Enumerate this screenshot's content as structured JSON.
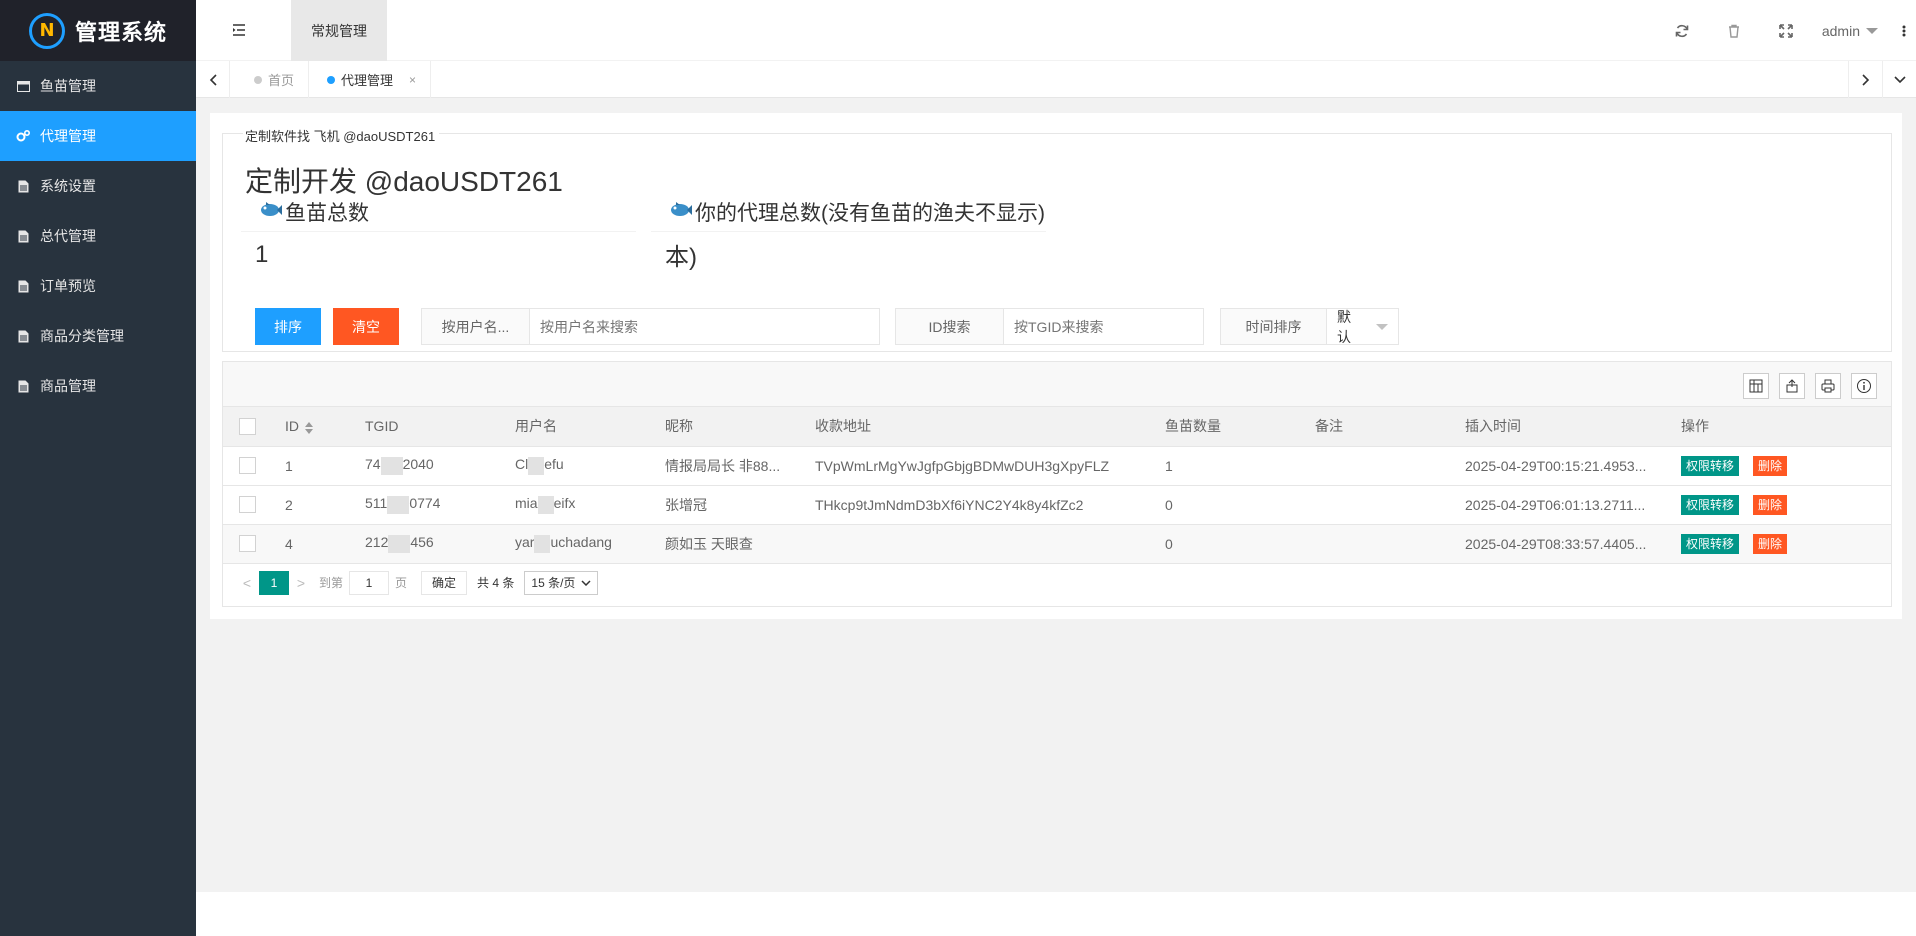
{
  "app": {
    "title": "管理系统",
    "logo_letter": "N"
  },
  "sidebar": {
    "items": [
      {
        "label": "鱼苗管理",
        "icon": "window-icon",
        "active": false
      },
      {
        "label": "代理管理",
        "icon": "gears-icon",
        "active": true
      },
      {
        "label": "系统设置",
        "icon": "document-icon",
        "active": false
      },
      {
        "label": "总代管理",
        "icon": "document-icon",
        "active": false
      },
      {
        "label": "订单预览",
        "icon": "document-icon",
        "active": false
      },
      {
        "label": "商品分类管理",
        "icon": "document-icon",
        "active": false
      },
      {
        "label": "商品管理",
        "icon": "document-icon",
        "active": false
      }
    ]
  },
  "header": {
    "nav_tab": "常规管理",
    "user": "admin"
  },
  "tabs": {
    "home": "首页",
    "current": "代理管理",
    "close": "×"
  },
  "panel": {
    "legend": "定制软件找 飞机 @daoUSDT261",
    "title": "定制开发 @daoUSDT261",
    "stats": [
      {
        "label": "鱼苗总数",
        "value": "1"
      },
      {
        "label": "你的代理总数(没有鱼苗的渔夫不显示)",
        "value": ""
      }
    ],
    "overlap_text": "本)"
  },
  "toolbar": {
    "sort_button": "排序",
    "clear_button": "清空",
    "username_label": "按用户名...",
    "username_placeholder": "按用户名来搜索",
    "id_label": "ID搜索",
    "id_placeholder": "按TGID来搜索",
    "time_label": "时间排序",
    "time_value": "默认"
  },
  "table": {
    "columns": [
      "ID",
      "TGID",
      "用户名",
      "昵称",
      "收款地址",
      "鱼苗数量",
      "备注",
      "插入时间",
      "操作"
    ],
    "rows": [
      {
        "id": "1",
        "tgid_a": "74",
        "tgid_b": "2040",
        "user_a": "Cl",
        "user_b": "efu",
        "nickname": "情报局局长 非88...",
        "address": "TVpWmLrMgYwJgfpGbjgBDMwDUH3gXpyFLZ",
        "count": "1",
        "note": "",
        "time": "2025-04-29T00:15:21.4953..."
      },
      {
        "id": "2",
        "tgid_a": "511",
        "tgid_b": "0774",
        "user_a": "mia",
        "user_b": "eifx",
        "nickname": "张增冠",
        "address": "THkcp9tJmNdmD3bXf6iYNC2Y4k8y4kfZc2",
        "count": "0",
        "note": "",
        "time": "2025-04-29T06:01:13.2711..."
      },
      {
        "id": "4",
        "tgid_a": "212",
        "tgid_b": "456",
        "user_a": "yar",
        "user_b": "uchadang",
        "nickname": "颜如玉 天眼查",
        "address": "",
        "count": "0",
        "note": "",
        "time": "2025-04-29T08:33:57.4405..."
      }
    ],
    "action_transfer": "权限转移",
    "action_delete": "删除"
  },
  "pager": {
    "prev": "<",
    "current": "1",
    "next": ">",
    "goto_label": "到第",
    "goto_value": "1",
    "page_unit": "页",
    "confirm": "确定",
    "total": "共 4 条",
    "per_page": "15 条/页"
  },
  "colors": {
    "primary": "#1e9fff",
    "danger": "#ff5722",
    "green": "#009688",
    "sidebar": "#28333e"
  }
}
